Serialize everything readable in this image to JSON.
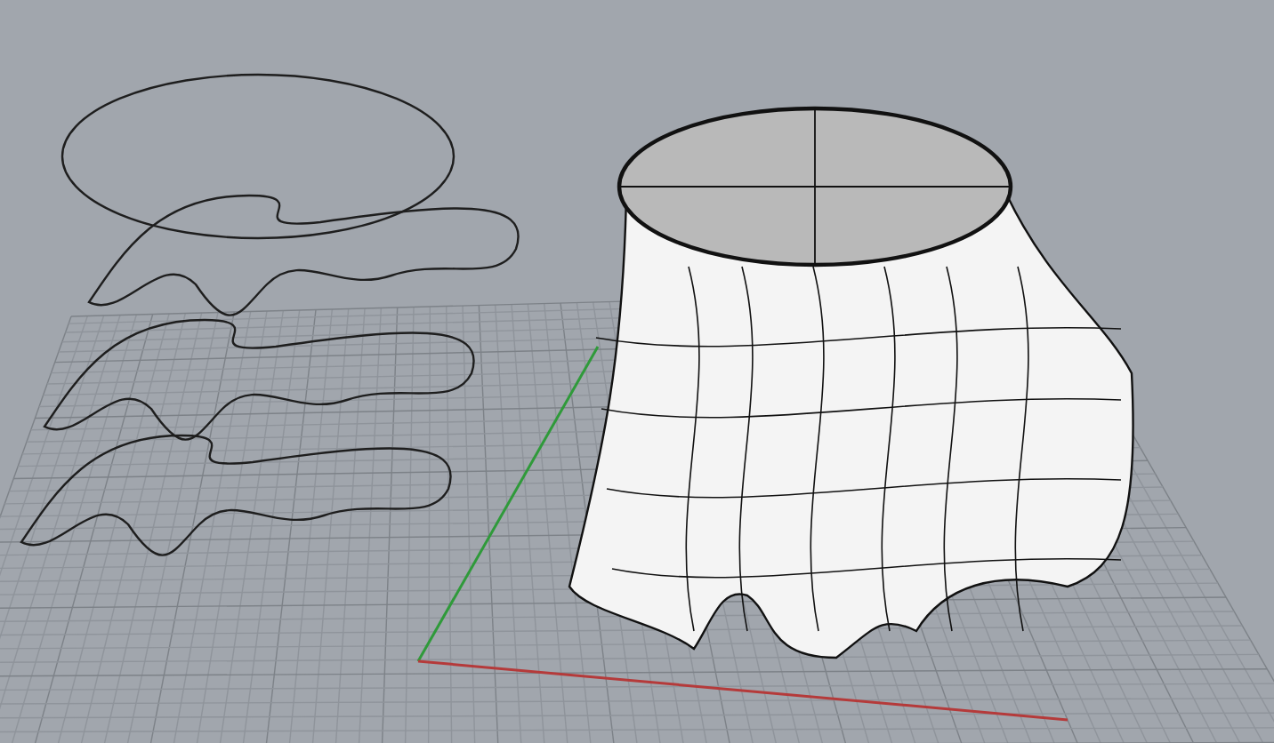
{
  "viewport": {
    "objects": [
      {
        "kind": "grid"
      },
      {
        "kind": "axes"
      },
      {
        "kind": "curves"
      },
      {
        "kind": "surface"
      }
    ]
  }
}
